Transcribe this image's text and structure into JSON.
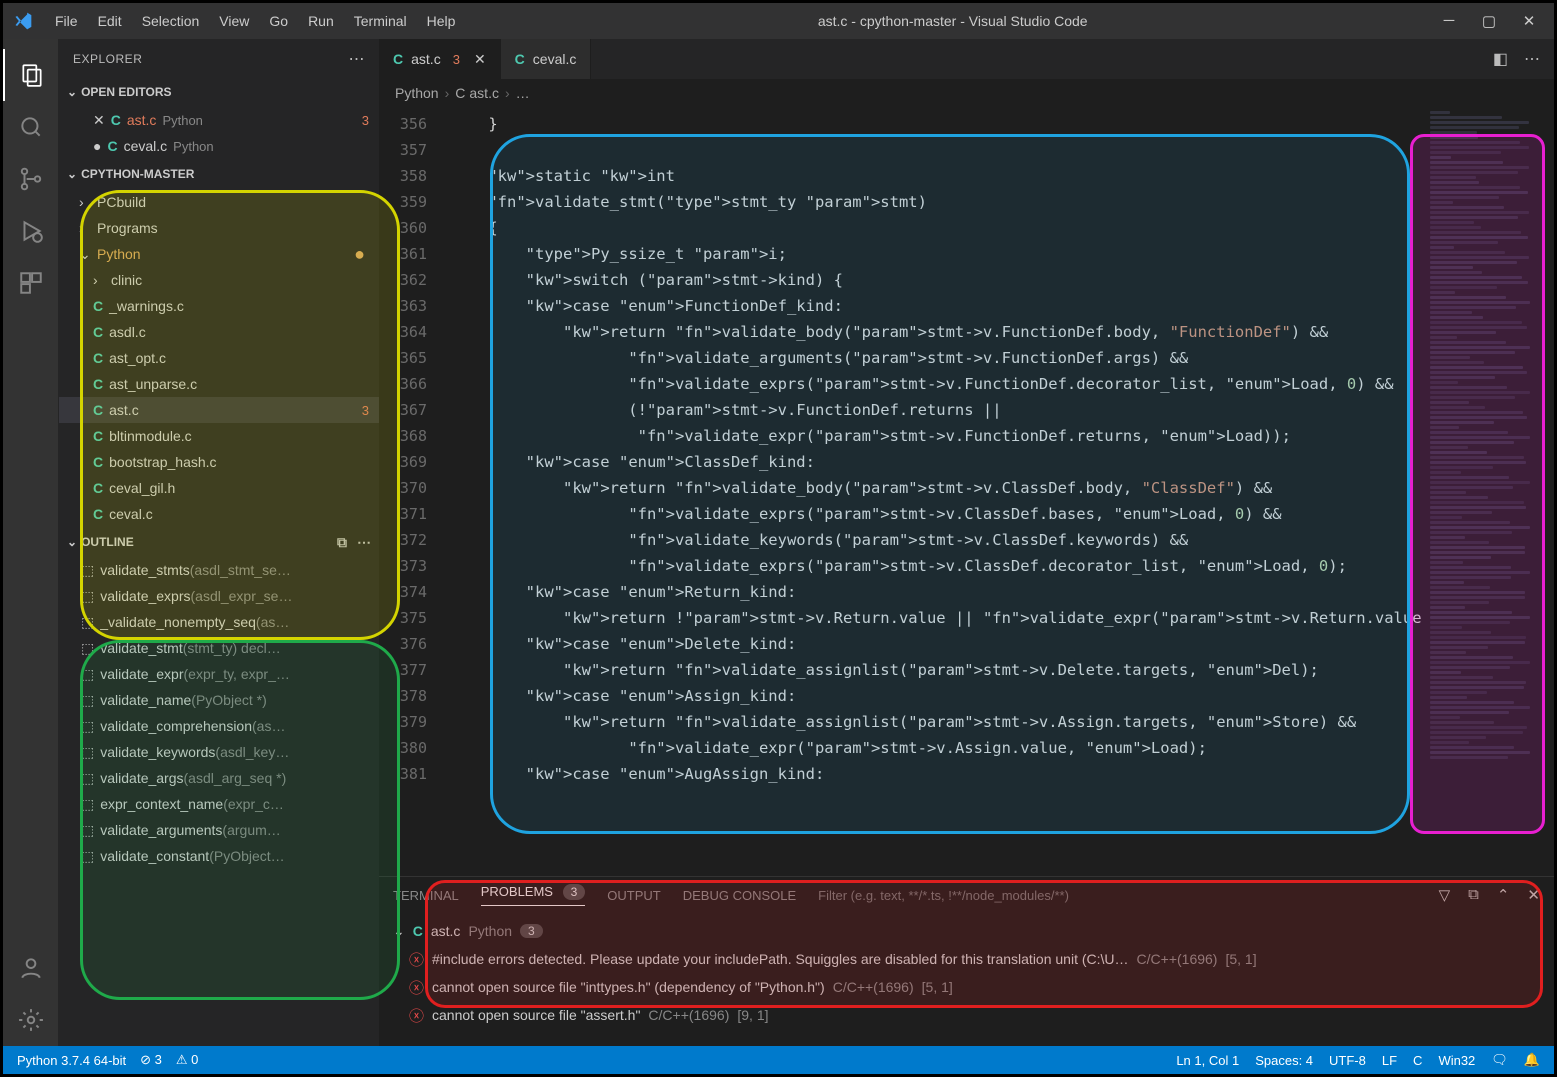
{
  "window": {
    "title": "ast.c - cpython-master - Visual Studio Code",
    "menus": [
      "File",
      "Edit",
      "Selection",
      "View",
      "Go",
      "Run",
      "Terminal",
      "Help"
    ]
  },
  "sidebar": {
    "title": "EXPLORER",
    "openEditorsLabel": "OPEN EDITORS",
    "openEditors": [
      {
        "name": "ast.c",
        "folder": "Python",
        "badge": "3",
        "modified": false,
        "active": true
      },
      {
        "name": "ceval.c",
        "folder": "Python",
        "badge": "",
        "modified": true,
        "active": false
      }
    ],
    "projectLabel": "CPYTHON-MASTER",
    "tree": [
      {
        "kind": "folder",
        "name": "PCbuild",
        "open": false,
        "indent": 0
      },
      {
        "kind": "folder",
        "name": "Programs",
        "open": false,
        "indent": 0
      },
      {
        "kind": "folder",
        "name": "Python",
        "open": true,
        "indent": 0,
        "gitmod": true
      },
      {
        "kind": "folder",
        "name": "clinic",
        "open": false,
        "indent": 1
      },
      {
        "kind": "file",
        "name": "_warnings.c",
        "indent": 1
      },
      {
        "kind": "file",
        "name": "asdl.c",
        "indent": 1
      },
      {
        "kind": "file",
        "name": "ast_opt.c",
        "indent": 1
      },
      {
        "kind": "file",
        "name": "ast_unparse.c",
        "indent": 1
      },
      {
        "kind": "file",
        "name": "ast.c",
        "indent": 1,
        "active": true,
        "badge": "3"
      },
      {
        "kind": "file",
        "name": "bltinmodule.c",
        "indent": 1
      },
      {
        "kind": "file",
        "name": "bootstrap_hash.c",
        "indent": 1
      },
      {
        "kind": "file",
        "name": "ceval_gil.h",
        "indent": 1
      },
      {
        "kind": "file",
        "name": "ceval.c",
        "indent": 1
      }
    ],
    "outlineLabel": "OUTLINE",
    "outline": [
      {
        "name": "validate_stmts",
        "sig": "(asdl_stmt_se…"
      },
      {
        "name": "validate_exprs",
        "sig": "(asdl_expr_se…"
      },
      {
        "name": "_validate_nonempty_seq",
        "sig": "(as…"
      },
      {
        "name": "validate_stmt",
        "sig": "(stmt_ty)",
        "decl": "decl…"
      },
      {
        "name": "validate_expr",
        "sig": "(expr_ty, expr_…"
      },
      {
        "name": "validate_name",
        "sig": "(PyObject *)"
      },
      {
        "name": "validate_comprehension",
        "sig": "(as…"
      },
      {
        "name": "validate_keywords",
        "sig": "(asdl_key…"
      },
      {
        "name": "validate_args",
        "sig": "(asdl_arg_seq *)"
      },
      {
        "name": "expr_context_name",
        "sig": "(expr_c…"
      },
      {
        "name": "validate_arguments",
        "sig": "(argum…"
      },
      {
        "name": "validate_constant",
        "sig": "(PyObject…"
      }
    ]
  },
  "tabs": [
    {
      "name": "ast.c",
      "badge": "3",
      "active": true,
      "close": true
    },
    {
      "name": "ceval.c",
      "badge": "",
      "active": false,
      "close": false
    }
  ],
  "breadcrumbs": [
    "Python",
    "ast.c",
    "…"
  ],
  "code": {
    "startLine": 356,
    "lines": [
      "    }",
      "",
      "    static int",
      "    validate_stmt(stmt_ty stmt)",
      "    {",
      "        Py_ssize_t i;",
      "        switch (stmt->kind) {",
      "        case FunctionDef_kind:",
      "            return validate_body(stmt->v.FunctionDef.body, \"FunctionDef\") &&",
      "                   validate_arguments(stmt->v.FunctionDef.args) &&",
      "                   validate_exprs(stmt->v.FunctionDef.decorator_list, Load, 0) &&",
      "                   (!stmt->v.FunctionDef.returns ||",
      "                    validate_expr(stmt->v.FunctionDef.returns, Load));",
      "        case ClassDef_kind:",
      "            return validate_body(stmt->v.ClassDef.body, \"ClassDef\") &&",
      "                   validate_exprs(stmt->v.ClassDef.bases, Load, 0) &&",
      "                   validate_keywords(stmt->v.ClassDef.keywords) &&",
      "                   validate_exprs(stmt->v.ClassDef.decorator_list, Load, 0);",
      "        case Return_kind:",
      "            return !stmt->v.Return.value || validate_expr(stmt->v.Return.value, Load);",
      "        case Delete_kind:",
      "            return validate_assignlist(stmt->v.Delete.targets, Del);",
      "        case Assign_kind:",
      "            return validate_assignlist(stmt->v.Assign.targets, Store) &&",
      "                   validate_expr(stmt->v.Assign.value, Load);",
      "        case AugAssign_kind:"
    ]
  },
  "panel": {
    "tabs": {
      "terminal": "TERMINAL",
      "problems": "PROBLEMS",
      "problemsBadge": "3",
      "output": "OUTPUT",
      "debug": "DEBUG CONSOLE"
    },
    "filterPlaceholder": "Filter (e.g. text, **/*.ts, !**/node_modules/**)",
    "problems": {
      "file": {
        "name": "ast.c",
        "folder": "Python",
        "badge": "3"
      },
      "items": [
        {
          "msg": "#include errors detected. Please update your includePath. Squiggles are disabled for this translation unit (C:\\U…",
          "src": "C/C++(1696)",
          "loc": "[5, 1]"
        },
        {
          "msg": "cannot open source file \"inttypes.h\" (dependency of \"Python.h\")",
          "src": "C/C++(1696)",
          "loc": "[5, 1]"
        },
        {
          "msg": "cannot open source file \"assert.h\"",
          "src": "C/C++(1696)",
          "loc": "[9, 1]"
        }
      ]
    }
  },
  "status": {
    "python": "Python 3.7.4 64-bit",
    "errors": "⊘ 3",
    "warnings": "⚠ 0",
    "ln": "Ln 1, Col 1",
    "spaces": "Spaces: 4",
    "encoding": "UTF-8",
    "eol": "LF",
    "lang": "C",
    "os": "Win32"
  }
}
